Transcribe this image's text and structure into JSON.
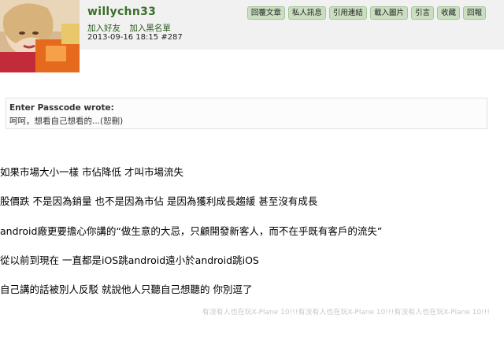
{
  "post": {
    "username": "willychn33",
    "add_friend": "加入好友",
    "add_blacklist": "加入黑名單",
    "timestamp": "2013-09-16 18:15",
    "post_number": "#287"
  },
  "actions": [
    "回覆文章",
    "私人訊息",
    "引用連結",
    "載入圖片",
    "引言",
    "收藏",
    "回報"
  ],
  "quote": {
    "title": "Enter Passcode wrote:",
    "text": "呵呵，想看自己想看的...(恕刪)"
  },
  "body_lines": [
    "如果市場大小一樣 市佔降低 才叫市場流失",
    "股價跌 不是因為銷量 也不是因為市佔 是因為獲利成長趨緩 甚至沒有成長",
    "android廠更要擔心你講的“做生意的大忌，只顧開發新客人，而不在乎既有客戶的流失”",
    "從以前到現在 一直都是iOS跳android遠小於android跳iOS",
    "自己講的話被別人反駁 就說他人只聽自己想聽的 你別逗了"
  ],
  "signature": "有沒有人也在玩X-Plane 10!!!有沒有人也在玩X-Plane 10!!!有沒有人也在玩X-Plane 10!!!"
}
